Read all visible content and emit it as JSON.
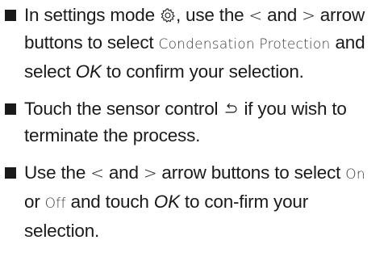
{
  "items": [
    {
      "t1": "In settings mode ",
      "icon": "gear-icon",
      "t2": ", use the ",
      "lt": "<",
      "t3": " and ",
      "gt": ">",
      "t4": " arrow buttons to select ",
      "display": "Condensation Protection",
      "t5": " and select ",
      "ok": "OK",
      "t6": " to confirm your selection."
    },
    {
      "t1": "Touch the sensor control ",
      "icon": "back-arrow-icon",
      "t2": " if you wish to terminate the process."
    },
    {
      "t1": "Use the ",
      "lt": "<",
      "t2": " and ",
      "gt": ">",
      "t3": " arrow buttons to select ",
      "on": "On",
      "t4": " or ",
      "off": "Off",
      "t5": " and touch ",
      "ok": "OK",
      "t6": " to con-firm your selection."
    }
  ]
}
